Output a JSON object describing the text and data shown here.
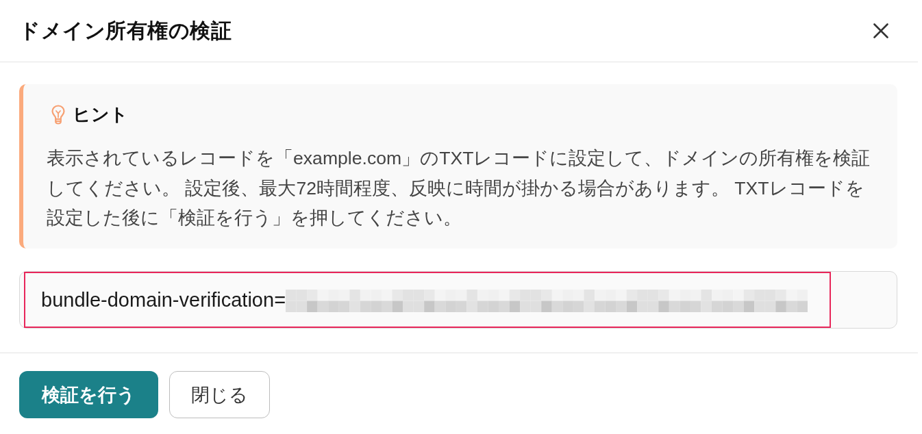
{
  "dialog": {
    "title": "ドメイン所有権の検証"
  },
  "hint": {
    "title": "ヒント",
    "text": "表示されているレコードを「example.com」のTXTレコードに設定して、ドメインの所有権を検証してください。 設定後、最大72時間程度、反映に時間が掛かる場合があります。 TXTレコードを設定した後に「検証を行う」を押してください。"
  },
  "record_field": {
    "value": "bundle-domain-verification=",
    "redacted": true,
    "highlighted": true
  },
  "buttons": [
    {
      "label": "検証を行う",
      "kind": "primary"
    },
    {
      "label": "閉じる",
      "kind": "secondary"
    }
  ]
}
